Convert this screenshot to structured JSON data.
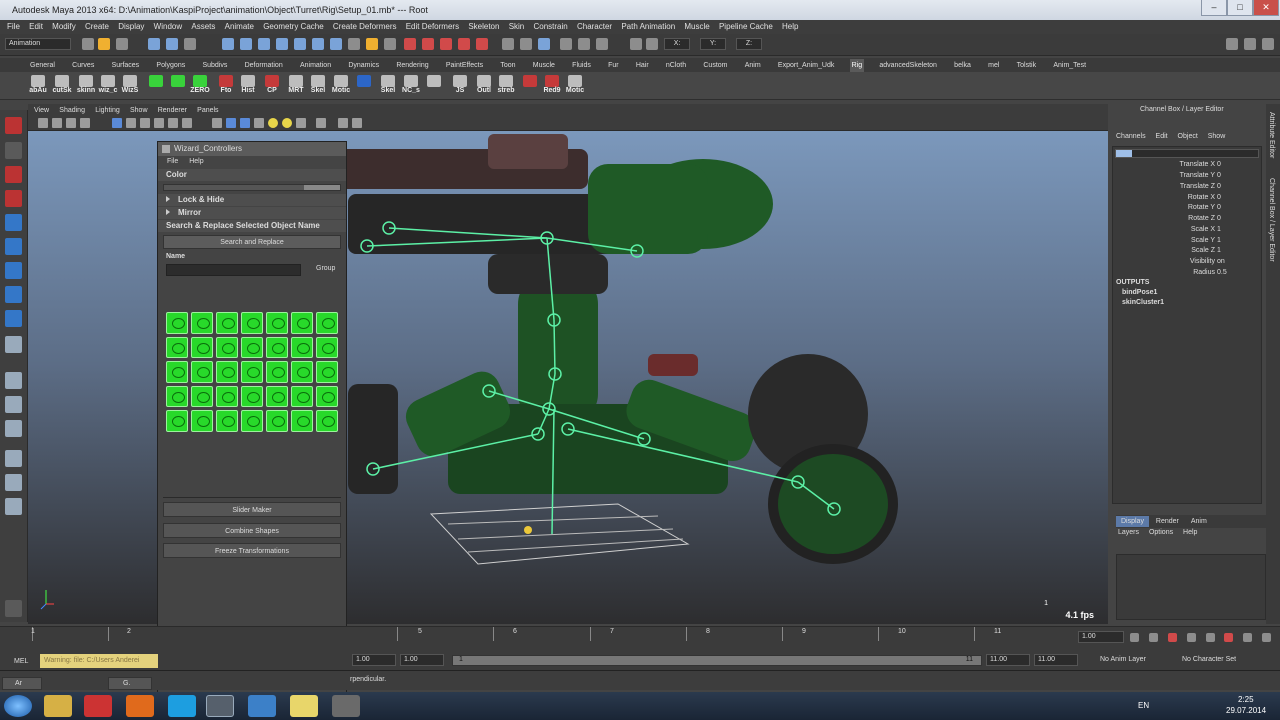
{
  "window": {
    "title": "Autodesk Maya 2013 x64: D:\\Animation\\KaspiProject\\animation\\Object\\Turret\\Rig\\Setup_01.mb* --- Root",
    "minimize": "–",
    "maximize": "□",
    "close": "✕"
  },
  "menubar": [
    "File",
    "Edit",
    "Modify",
    "Create",
    "Display",
    "Window",
    "Assets",
    "Animate",
    "Geometry Cache",
    "Create Deformers",
    "Edit Deformers",
    "Skeleton",
    "Skin",
    "Constrain",
    "Character",
    "Path Animation",
    "Muscle",
    "Pipeline Cache",
    "Help"
  ],
  "statusline": {
    "mode": "Animation",
    "field_x": "X:",
    "field_y": "Y:",
    "field_z": "Z:"
  },
  "shelf_tabs": [
    "General",
    "Curves",
    "Surfaces",
    "Polygons",
    "Subdivs",
    "Deformation",
    "Animation",
    "Dynamics",
    "Rendering",
    "PaintEffects",
    "Toon",
    "Muscle",
    "Fluids",
    "Fur",
    "Hair",
    "nCloth",
    "Custom",
    "Anim",
    "Export_Anim_Udk",
    "Rig",
    "advancedSkeleton",
    "belka",
    "mel",
    "Tolstik",
    "Anim_Test"
  ],
  "shelf_active": "Rig",
  "shelf_tools": [
    {
      "label": "abAu",
      "color": "w"
    },
    {
      "label": "cutSk",
      "color": "w"
    },
    {
      "label": "skinn",
      "color": "w"
    },
    {
      "label": "wiz_c",
      "color": "w"
    },
    {
      "label": "WizS",
      "color": "w"
    },
    {
      "label": "",
      "color": "g"
    },
    {
      "label": "",
      "color": "g"
    },
    {
      "label": "ZERO",
      "color": "g"
    },
    {
      "label": "Fto",
      "color": "r"
    },
    {
      "label": "Hist",
      "color": "w"
    },
    {
      "label": "CP",
      "color": "r"
    },
    {
      "label": "MRT",
      "color": "w"
    },
    {
      "label": "Skel",
      "color": "w"
    },
    {
      "label": "Motic",
      "color": "w"
    },
    {
      "label": "",
      "color": "b"
    },
    {
      "label": "Skel",
      "color": "w"
    },
    {
      "label": "NC_s",
      "color": "w"
    },
    {
      "label": "",
      "color": "w"
    },
    {
      "label": "JS",
      "color": "w"
    },
    {
      "label": "Outl",
      "color": "w"
    },
    {
      "label": "streb",
      "color": "w"
    },
    {
      "label": "",
      "color": "r"
    },
    {
      "label": "Red9",
      "color": "r"
    },
    {
      "label": "Motic",
      "color": "w"
    }
  ],
  "viewport": {
    "menu": [
      "View",
      "Shading",
      "Lighting",
      "Show",
      "Renderer",
      "Panels"
    ],
    "fps": "4.1 fps",
    "overlay_number": "1"
  },
  "wizard": {
    "title": "Wizard_Controllers",
    "menu": [
      "File",
      "Help"
    ],
    "color_label": "Color",
    "lock_hide": "Lock & Hide",
    "mirror": "Mirror",
    "search_replace_header": "Search & Replace Selected Object Name",
    "search_replace_button": "Search and Replace",
    "name_label": "Name",
    "group_label": "Group",
    "slider_maker": "Slider Maker",
    "combine_shapes": "Combine Shapes",
    "freeze_transformations": "Freeze Transformations"
  },
  "channel_box": {
    "header": "Channel Box / Layer Editor",
    "menu": [
      "Channels",
      "Edit",
      "Object",
      "Show"
    ],
    "attributes": [
      {
        "name": "Translate X",
        "value": "0"
      },
      {
        "name": "Translate Y",
        "value": "0"
      },
      {
        "name": "Translate Z",
        "value": "0"
      },
      {
        "name": "Rotate X",
        "value": "0"
      },
      {
        "name": "Rotate Y",
        "value": "0"
      },
      {
        "name": "Rotate Z",
        "value": "0"
      },
      {
        "name": "Scale X",
        "value": "1"
      },
      {
        "name": "Scale Y",
        "value": "1"
      },
      {
        "name": "Scale Z",
        "value": "1"
      },
      {
        "name": "Visibility",
        "value": "on"
      },
      {
        "name": "Radius",
        "value": "0.5"
      }
    ],
    "outputs_label": "OUTPUTS",
    "outputs": [
      "bindPose1",
      "skinCluster1"
    ]
  },
  "layer_editor": {
    "tabs": [
      "Display",
      "Render",
      "Anim"
    ],
    "menu": [
      "Layers",
      "Options",
      "Help"
    ]
  },
  "side_tabs": [
    "Attribute Editor",
    "Channel Box / Layer Editor"
  ],
  "timeline": {
    "ticks": [
      "1",
      "2",
      "3",
      "4",
      "5",
      "6",
      "7",
      "8",
      "9",
      "10",
      "11"
    ],
    "current_frame": "1.00"
  },
  "range": {
    "start": "1.00",
    "playback_start": "1.00",
    "slider_start": "1",
    "slider_end": "11",
    "playback_end": "11.00",
    "end": "11.00",
    "anim_layer": "No Anim Layer",
    "character_set": "No Character Set"
  },
  "cmdline": {
    "lang": "MEL",
    "warning": "Warning: file: C:/Users Anderei",
    "help": "rpendicular."
  },
  "taskbar": {
    "lang": "EN",
    "time": "2:25",
    "date": "29.07.2014",
    "win1": "Ar",
    "win2": "G."
  }
}
